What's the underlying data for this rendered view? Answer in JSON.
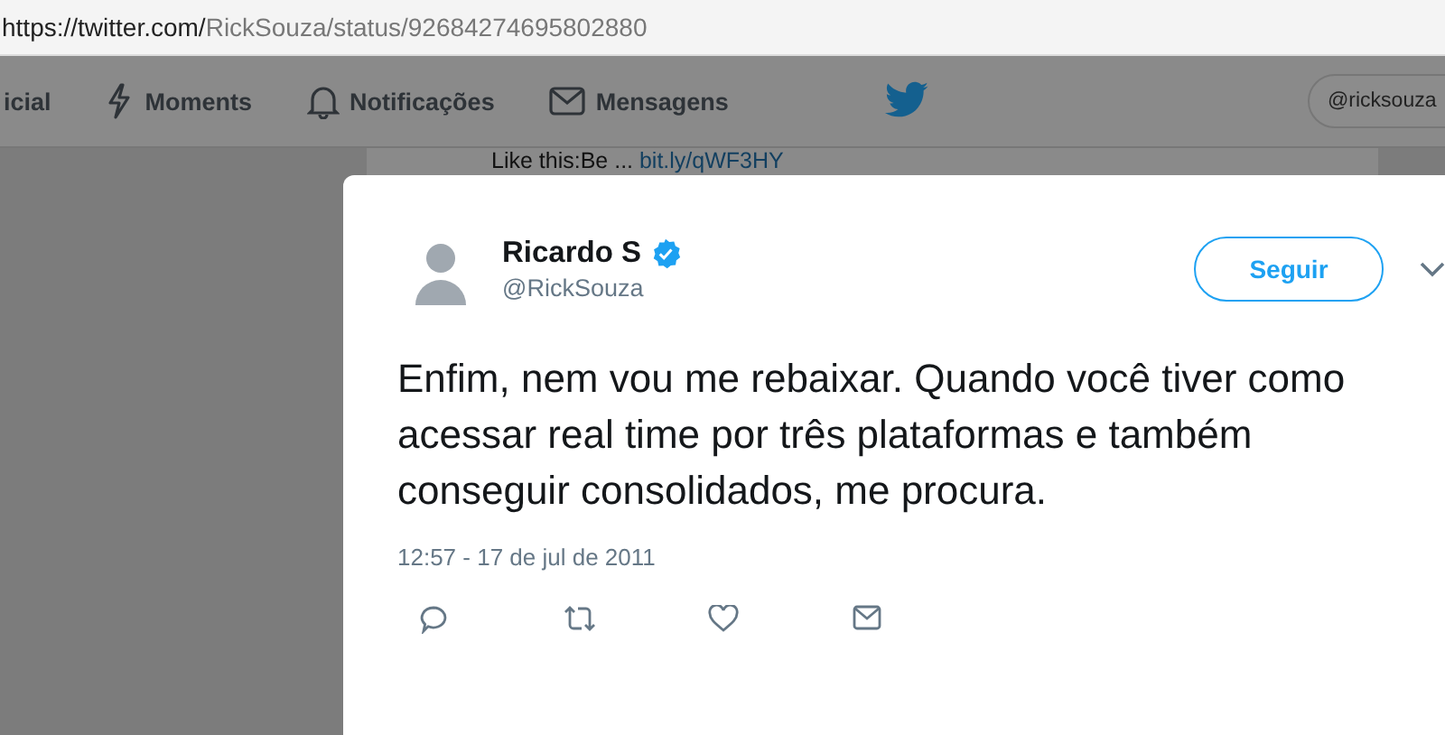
{
  "address_bar": {
    "url_host": "https://twitter.com/",
    "url_path": "RickSouza/status/92684274695802880"
  },
  "nav": {
    "items": [
      {
        "label": "icial",
        "kind": "home"
      },
      {
        "label": "Moments",
        "kind": "moments"
      },
      {
        "label": "Notificações",
        "kind": "notifications"
      },
      {
        "label": "Mensagens",
        "kind": "messages"
      }
    ],
    "account": "@ricksouza"
  },
  "background_tweet": {
    "text": "Like this:Be ...",
    "link": "bit.ly/qWF3HY"
  },
  "tweet": {
    "name": "Ricardo S",
    "verified": true,
    "handle": "@RickSouza",
    "follow_button": "Seguir",
    "text": "Enfim, nem vou me rebaixar. Quando você tiver como acessar real time por três plataformas e também conseguir consolidados, me procura.",
    "timestamp": "12:57 - 17 de jul de 2011",
    "actions": [
      {
        "kind": "reply"
      },
      {
        "kind": "retweet"
      },
      {
        "kind": "like"
      },
      {
        "kind": "message"
      }
    ]
  }
}
